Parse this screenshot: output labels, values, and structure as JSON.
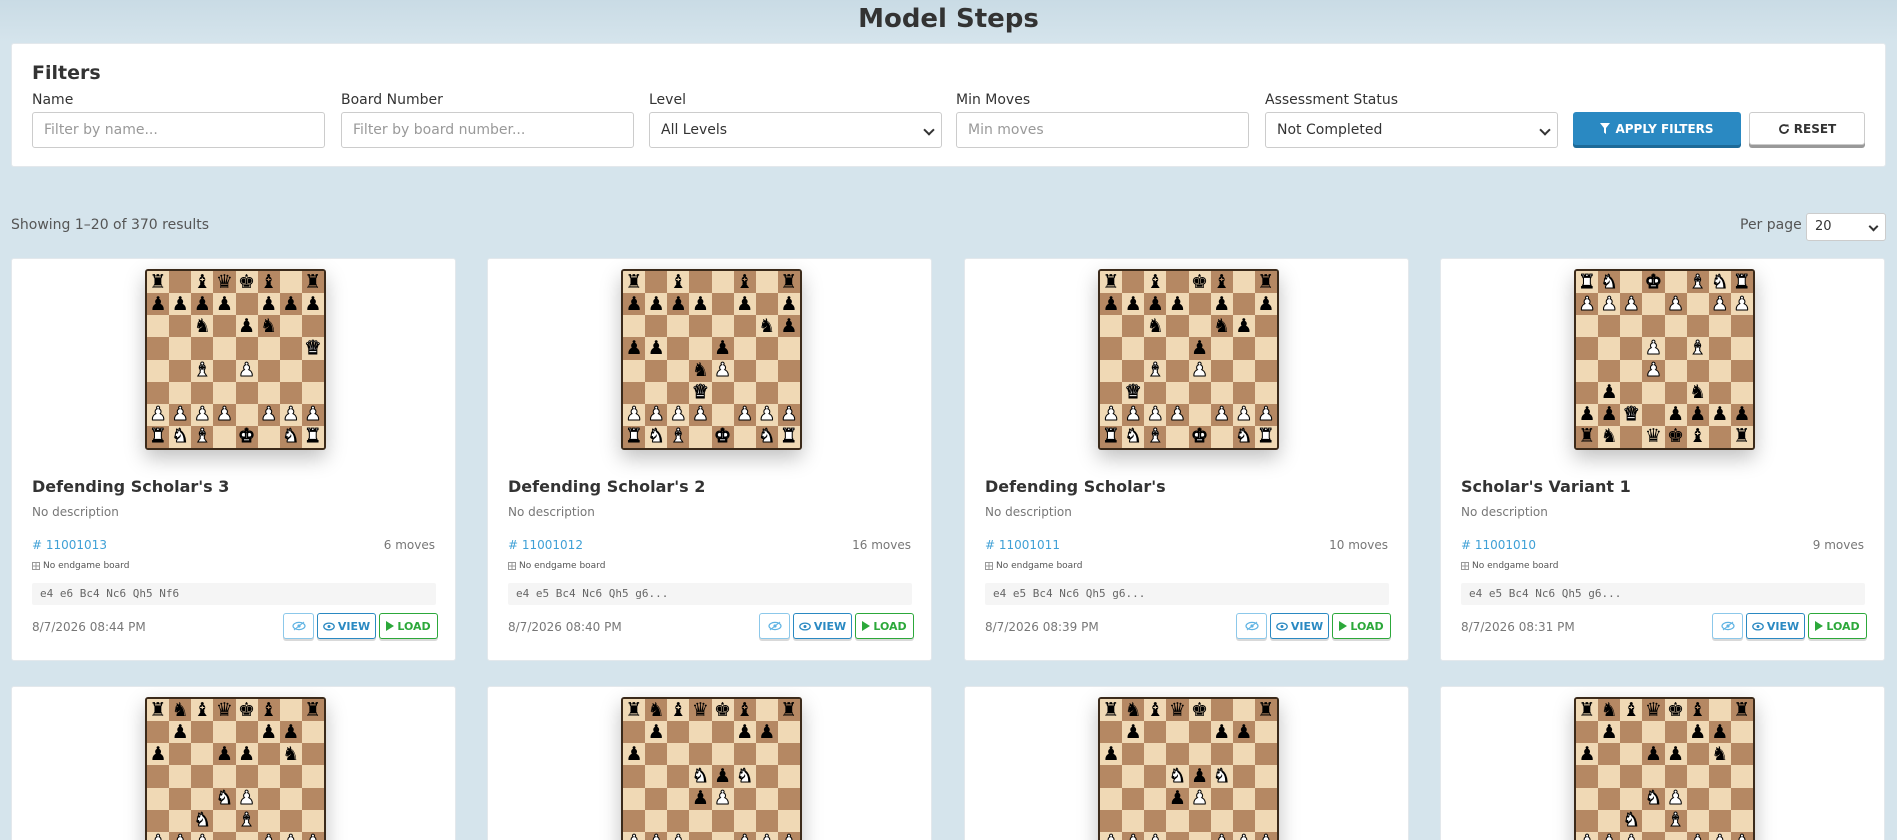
{
  "header": {
    "title": "Model Steps"
  },
  "filters": {
    "title": "Filters",
    "name": {
      "label": "Name",
      "placeholder": "Filter by name..."
    },
    "board_number": {
      "label": "Board Number",
      "placeholder": "Filter by board number..."
    },
    "level": {
      "label": "Level",
      "value": "All Levels"
    },
    "min_moves": {
      "label": "Min Moves",
      "placeholder": "Min moves"
    },
    "assessment_status": {
      "label": "Assessment Status",
      "value": "Not Completed"
    },
    "apply_label": "APPLY FILTERS",
    "reset_label": "RESET"
  },
  "results": {
    "showing": "Showing 1–20 of 370 results",
    "per_page_label": "Per page",
    "per_page_value": "20"
  },
  "common": {
    "view_label": "VIEW",
    "load_label": "LOAD",
    "endgame_text": "No endgame board"
  },
  "cards": [
    {
      "title": "Defending Scholar's 3",
      "description": "No description",
      "number": "# 11001013",
      "moves": "6 moves",
      "pgn": "e4 e6 Bc4 Nc6 Qh5 Nf6",
      "date": "8/7/2026 08:44 PM",
      "board": [
        "r.bqkb.r",
        "pppp.ppp",
        "..n.pn..",
        ".......Q",
        "..B.P...",
        "........",
        "PPPP.PPP",
        "RNB.K.NR"
      ]
    },
    {
      "title": "Defending Scholar's 2",
      "description": "No description",
      "number": "# 11001012",
      "moves": "16 moves",
      "pgn": "e4 e5 Bc4 Nc6 Qh5 g6...",
      "date": "8/7/2026 08:40 PM",
      "board": [
        "r.b..b.r",
        "pppp.p.p",
        "......np",
        "pp..p...",
        "...nP...",
        "...Q....",
        "PPPP.PPP",
        "RNB.K.NR"
      ]
    },
    {
      "title": "Defending Scholar's",
      "description": "No description",
      "number": "# 11001011",
      "moves": "10 moves",
      "pgn": "e4 e5 Bc4 Nc6 Qh5 g6...",
      "date": "8/7/2026 08:39 PM",
      "board": [
        "r.b.kb.r",
        "pppp.p.p",
        "..n..np.",
        "....p...",
        "..B.P...",
        ".Q......",
        "PPPP.PPP",
        "RNB.K.NR"
      ]
    },
    {
      "title": "Scholar's Variant 1",
      "description": "No description",
      "number": "# 11001010",
      "moves": "9 moves",
      "pgn": "e4 e5 Bc4 Nc6 Qh5 g6...",
      "date": "8/7/2026 08:31 PM",
      "board": [
        "RN.K.BNR",
        "PPP.P.PP",
        "........",
        "...P.B..",
        "...P....",
        ".p...n..",
        "ppQ.pppp",
        "rn.qkb.r"
      ]
    },
    {
      "title": "",
      "description": "",
      "number": "",
      "moves": "",
      "pgn": "",
      "date": "",
      "board": [
        "rnbqkb.r",
        ".p...pp.",
        "p..pp.n.",
        "........",
        "...NP...",
        "..N.B...",
        "PPP..PPP",
        "R..QKB.R"
      ]
    },
    {
      "title": "",
      "description": "",
      "number": "",
      "moves": "",
      "pgn": "",
      "date": "",
      "board": [
        "rnbqkb.r",
        ".p...pp.",
        "p.......",
        "...NpN..",
        "...pP...",
        "........",
        "PPP..PPP",
        "R..QKB.R"
      ]
    },
    {
      "title": "",
      "description": "",
      "number": "",
      "moves": "",
      "pgn": "",
      "date": "",
      "board": [
        "rnbqk..r",
        ".p...pp.",
        "p.......",
        "...NpN..",
        "...pP...",
        "........",
        "PPP..PPP",
        "R..QKB.R"
      ]
    },
    {
      "title": "",
      "description": "",
      "number": "",
      "moves": "",
      "pgn": "",
      "date": "",
      "board": [
        "rnbqkb.r",
        ".p...pp.",
        "p..pp.n.",
        "........",
        "...NP...",
        "..N.B...",
        "PPP..PPP",
        "R..QKB.R"
      ]
    }
  ]
}
